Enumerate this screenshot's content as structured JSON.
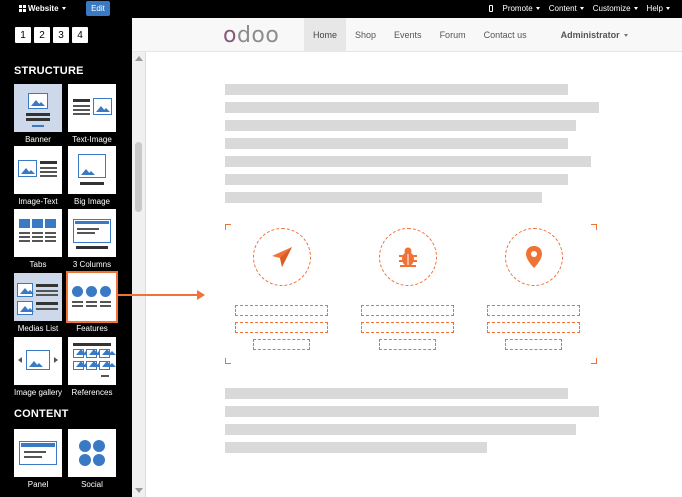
{
  "topbar": {
    "website_label": "Website",
    "edit_label": "Edit",
    "menus": [
      "Promote",
      "Content",
      "Customize",
      "Help"
    ]
  },
  "sidebar": {
    "pages": [
      "1",
      "2",
      "3",
      "4"
    ],
    "structure_title": "STRUCTURE",
    "content_title": "CONTENT",
    "snippets": [
      {
        "label": "Banner"
      },
      {
        "label": "Text-Image"
      },
      {
        "label": "Image-Text"
      },
      {
        "label": "Big Image"
      },
      {
        "label": "Tabs"
      },
      {
        "label": "3 Columns"
      },
      {
        "label": "Medias List"
      },
      {
        "label": "Features"
      },
      {
        "label": "Image gallery"
      },
      {
        "label": "References"
      },
      {
        "label": "Panel"
      },
      {
        "label": "Social"
      }
    ]
  },
  "site": {
    "logo": {
      "first": "o",
      "rest": "doo"
    },
    "nav": [
      "Home",
      "Shop",
      "Events",
      "Forum",
      "Contact us"
    ],
    "active_nav": "Home",
    "user_menu": "Administrator"
  },
  "colors": {
    "accent": "#ef7237",
    "edit_button": "#3a7ac4",
    "logo_purple": "#875a7b",
    "placeholder_gray": "#d9d9d9"
  },
  "feature_icons": [
    "paper-plane-icon",
    "bug-icon",
    "map-marker-icon"
  ]
}
